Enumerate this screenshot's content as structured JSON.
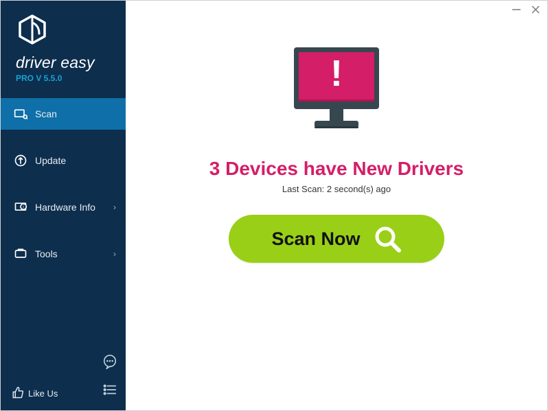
{
  "brand": {
    "name": "driver easy",
    "version": "PRO V 5.5.0"
  },
  "nav": {
    "scan": "Scan",
    "update": "Update",
    "hardware": "Hardware Info",
    "tools": "Tools"
  },
  "sidebar_bottom": {
    "like_us": "Like Us"
  },
  "main": {
    "headline": "3 Devices have New Drivers",
    "subline": "Last Scan: 2 second(s) ago",
    "scan_button": "Scan Now"
  },
  "colors": {
    "accent": "#d41e67",
    "sidebar_bg": "#0d2e4d",
    "scan_bg": "#99cf16"
  }
}
